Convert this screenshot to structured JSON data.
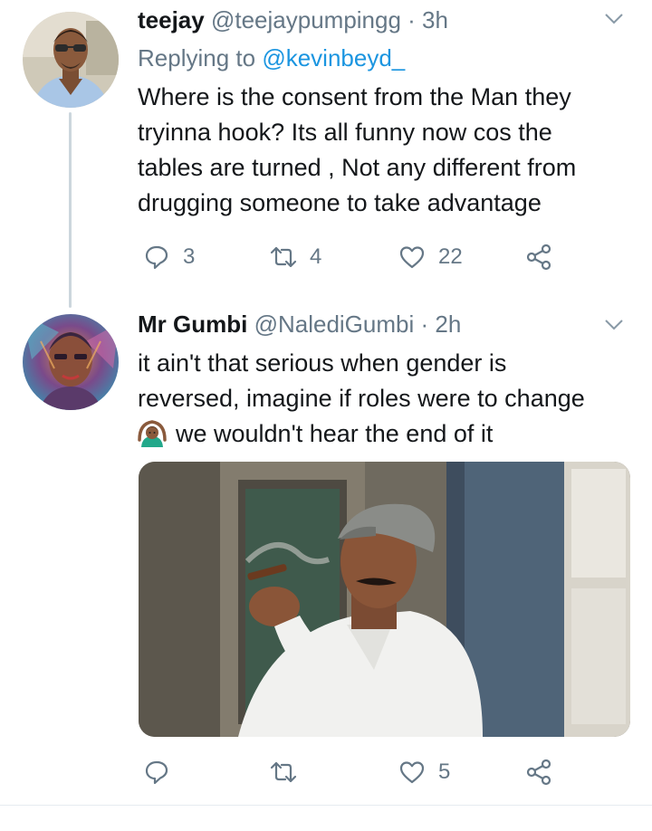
{
  "tweets": [
    {
      "name": "teejay",
      "handle": "@teejaypumpingg",
      "time_sep": " · ",
      "time": "3h",
      "replying_prefix": "Replying to ",
      "replying_handle": "@kevinbeyd_",
      "lines": [
        "Where is the consent from the Man they",
        "tryinna hook?  Its all funny now cos the",
        "tables are turned , Not any different from",
        "drugging someone to take advantage"
      ],
      "reply_count": "3",
      "retweet_count": "4",
      "like_count": "22"
    },
    {
      "name": "Mr Gumbi",
      "handle": "@NalediGumbi",
      "time_sep": " · ",
      "time": "2h",
      "lines": [
        "it ain't that serious when gender is",
        "reversed, imagine if roles were to change",
        "we wouldn't hear the end of it"
      ],
      "emoji": "person-gesturing-ok-emoji",
      "reply_count": "",
      "retweet_count": "",
      "like_count": "5"
    }
  ],
  "icons": {
    "reply": "reply-icon",
    "retweet": "retweet-icon",
    "like": "heart-icon",
    "share": "share-icon",
    "menu": "chevron-down-icon"
  },
  "colors": {
    "text": "#14171a",
    "muted": "#657786",
    "link": "#1b95e0",
    "thread_line": "#ccd6dd"
  }
}
